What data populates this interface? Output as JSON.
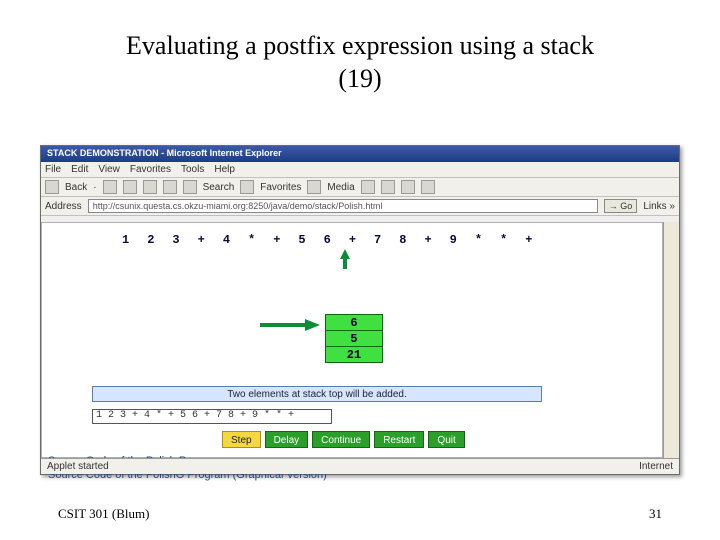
{
  "slide": {
    "title_line1": "Evaluating a postfix expression using a stack",
    "title_line2": "(19)",
    "footer_left": "CSIT 301 (Blum)",
    "footer_right": "31"
  },
  "ie": {
    "title": "STACK DEMONSTRATION - Microsoft Internet Explorer",
    "menu": [
      "File",
      "Edit",
      "View",
      "Favorites",
      "Tools",
      "Help"
    ],
    "toolbar": {
      "back": "Back",
      "search": "Search",
      "favorites": "Favorites",
      "media": "Media"
    },
    "address_label": "Address",
    "url": "http://csunix.questa.cs.okzu-miami.org:8250/java/demo/stack/Polish.html",
    "go": "Go",
    "links": "Links »"
  },
  "applet": {
    "expression": [
      "1",
      "2",
      "3",
      "+",
      "4",
      "*",
      "+",
      "5",
      "6",
      "+",
      "7",
      "8",
      "+",
      "9",
      "*",
      "*",
      "+"
    ],
    "pointer_index": 8,
    "stack_cells": [
      "6",
      "5",
      "21"
    ],
    "message": "Two elements at stack top will be added.",
    "input_value": "1 2 3 + 4 * + 5 6 + 7 8 + 9 * * +",
    "buttons": {
      "step": "Step",
      "delay": "Delay",
      "continue": "Continue",
      "restart": "Restart",
      "quit": "Quit"
    },
    "link1": "Source Code of the Polish Program",
    "link2": "Source Code of the PolishG Program (Graphical Version)"
  },
  "status": {
    "left": "Applet started",
    "right": "Internet"
  }
}
